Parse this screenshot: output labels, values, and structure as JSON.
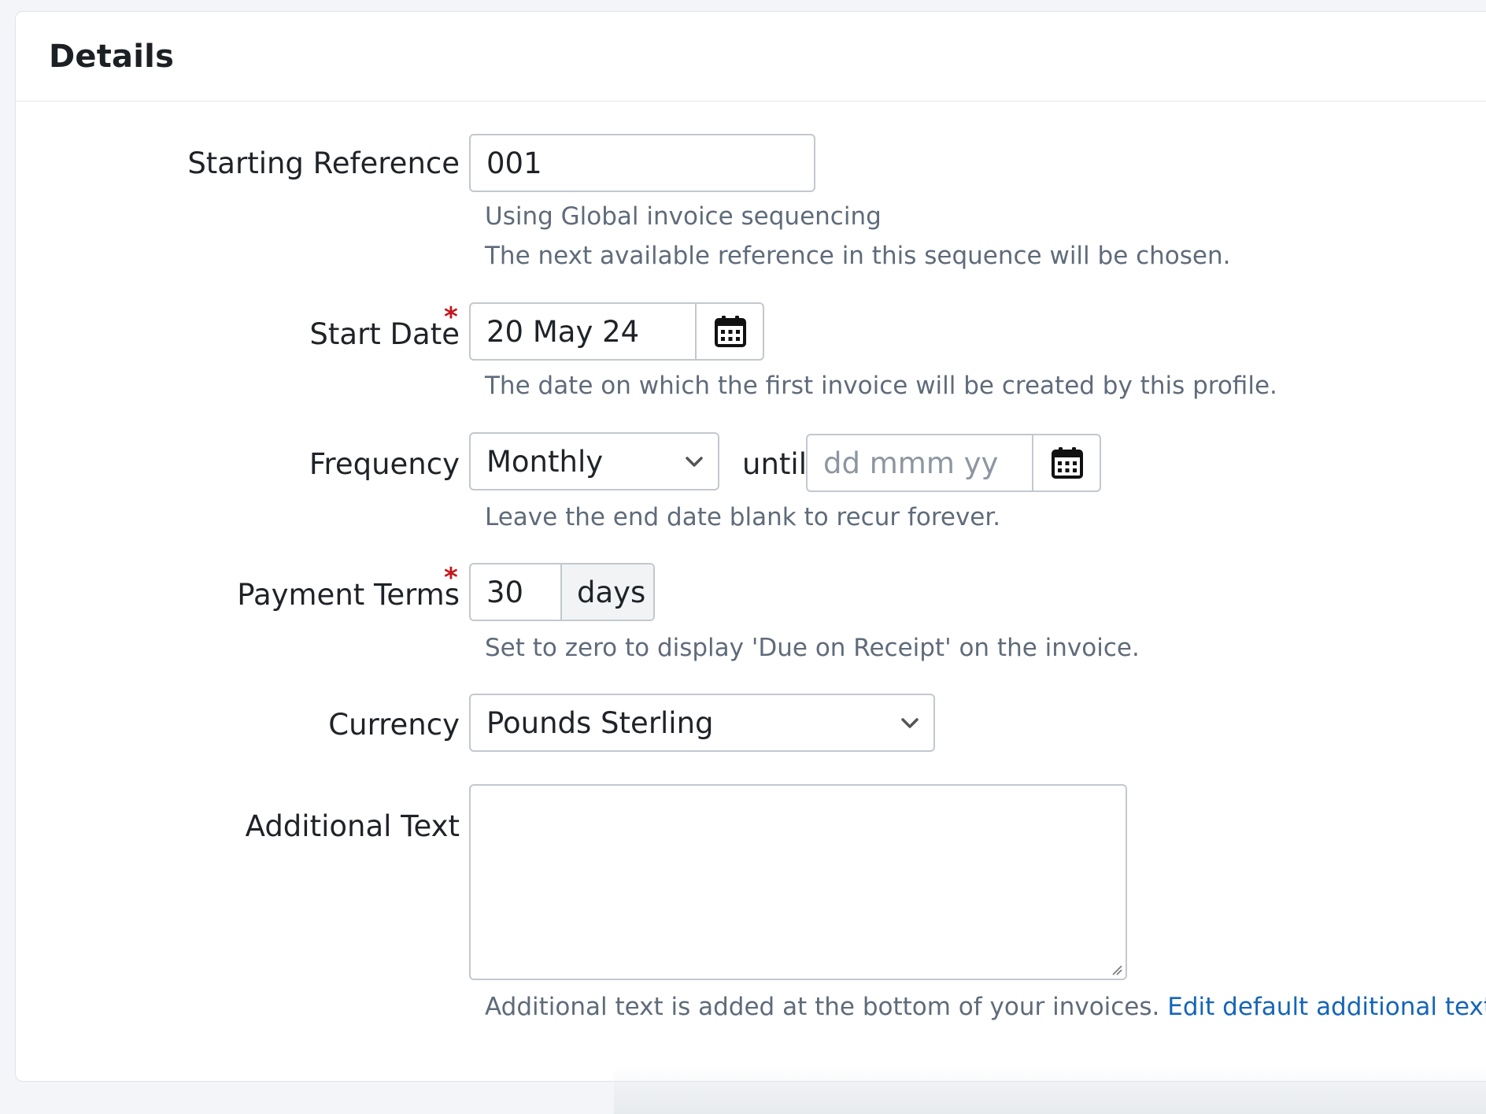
{
  "panel": {
    "title": "Details"
  },
  "form": {
    "starting_reference": {
      "label": "Starting Reference",
      "value": "001",
      "help_line1": "Using Global invoice sequencing",
      "help_line2": "The next available reference in this sequence will be chosen."
    },
    "start_date": {
      "label": "Start Date",
      "required_mark": "*",
      "value": "20 May 24",
      "icon": "calendar-icon",
      "help": "The date on which the first invoice will be created by this profile."
    },
    "frequency": {
      "label": "Frequency",
      "selected": "Monthly",
      "until_label": "until",
      "end_date_placeholder": "dd mmm yy",
      "icon": "calendar-icon",
      "help": "Leave the end date blank to recur forever."
    },
    "payment_terms": {
      "label": "Payment Terms",
      "required_mark": "*",
      "value": "30",
      "unit": "days",
      "help": "Set to zero to display 'Due on Receipt' on the invoice."
    },
    "currency": {
      "label": "Currency",
      "selected": "Pounds Sterling"
    },
    "additional_text": {
      "label": "Additional Text",
      "value": "",
      "help": "Additional text is added at the bottom of your invoices.",
      "help_link": "Edit default additional text"
    }
  },
  "colors": {
    "required": "#c4161c",
    "link": "#1565b8",
    "help_text": "#5f6b7a",
    "border": "#c3c8cf"
  }
}
